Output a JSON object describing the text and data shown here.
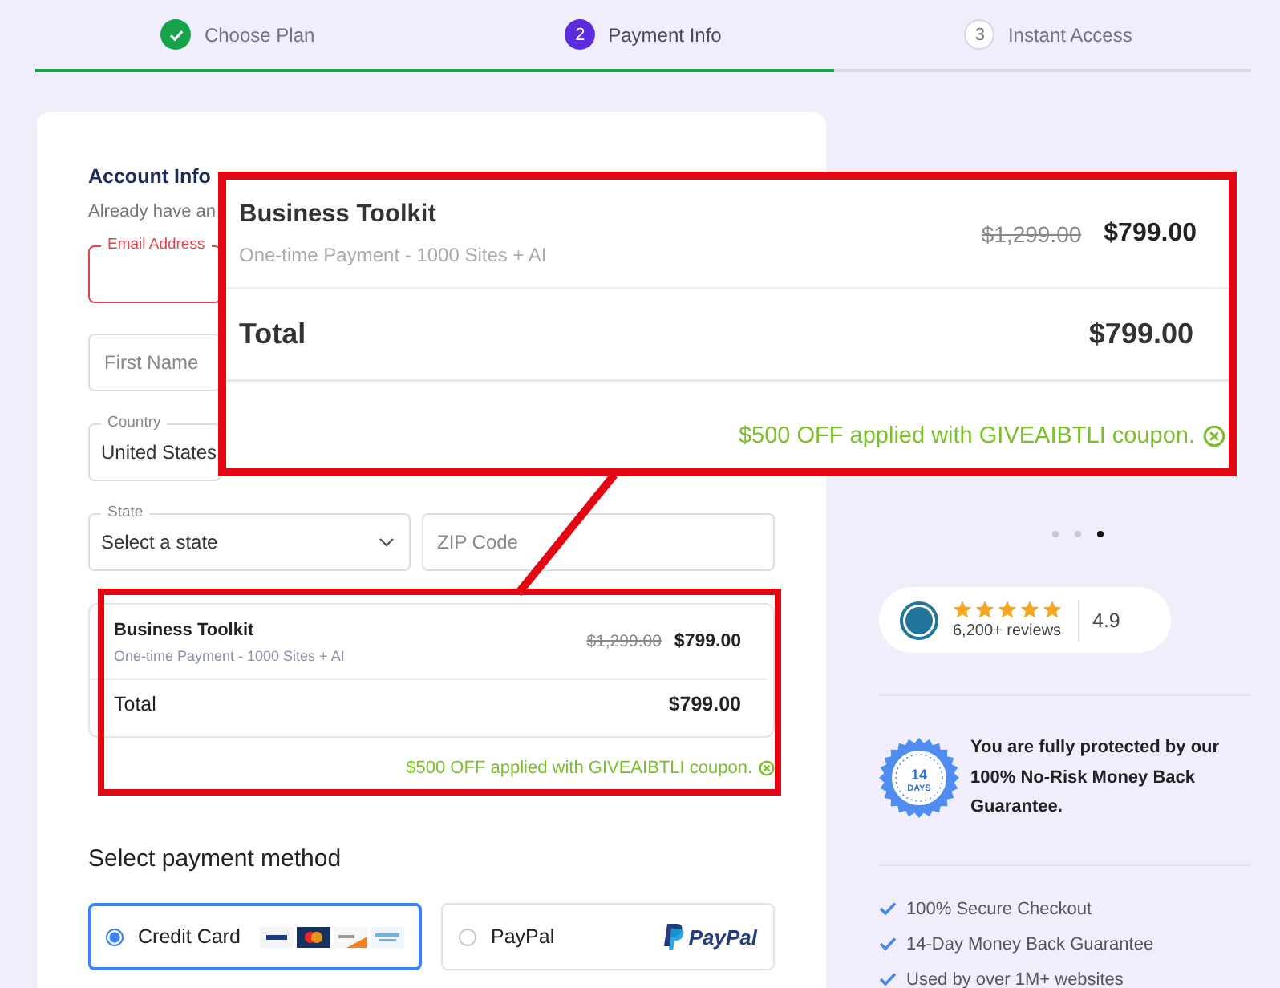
{
  "stepper": {
    "steps": [
      {
        "label": "Choose Plan",
        "completed": true,
        "selected": false
      },
      {
        "label": "Payment Info",
        "number": "2",
        "completed": false,
        "selected": true
      },
      {
        "label": "Instant Access",
        "number": "3",
        "completed": false,
        "selected": false
      }
    ],
    "progress": {
      "level": 0.657
    }
  },
  "account": {
    "heading": "Account Info",
    "subtext": "Already have an",
    "rows": [
      {
        "fields": [
          {
            "kind": "input",
            "label": "Email Address",
            "error": true
          }
        ]
      },
      {
        "fields": [
          {
            "kind": "input",
            "placeholder": "First Name",
            "error": false
          }
        ]
      },
      {
        "fields": [
          {
            "kind": "select",
            "label": "Country",
            "value": "United States",
            "error": false
          }
        ]
      },
      {
        "fields": [
          {
            "kind": "select",
            "label": "State",
            "value": "Select a state",
            "dropdown": true,
            "error": false
          },
          {
            "kind": "input",
            "placeholder": "ZIP Code",
            "error": false
          }
        ]
      }
    ]
  },
  "order_summary": {
    "item": "Business Toolkit",
    "description": "One-time Payment - 1000 Sites + AI",
    "old_price": "$1,299.00",
    "price": "$799.00",
    "total_label": "Total",
    "total": "$799.00",
    "coupon": "$500 OFF applied with GIVEAIBTLI coupon."
  },
  "payment": {
    "heading": "Select payment method",
    "methods": [
      {
        "label": "Credit Card",
        "kind": "card",
        "selected": true
      },
      {
        "label": "PayPal",
        "kind": "paypal",
        "logo": "PayPal",
        "selected": false
      }
    ]
  },
  "carousel": {
    "dots": [
      {
        "selected": false
      },
      {
        "selected": false
      },
      {
        "selected": true
      }
    ]
  },
  "reviews": {
    "stars": 5,
    "count": "6,200+ reviews",
    "rating": "4.9"
  },
  "guarantee": {
    "badge_number": "14",
    "badge_unit": "DAYS",
    "text": "You are fully protected by our 100% No-Risk Money Back Guarantee."
  },
  "features": [
    "100% Secure Checkout",
    "14-Day Money Back Guarantee",
    "Used by over 1M+ websites"
  ],
  "callout": {
    "item": "Business Toolkit",
    "description": "One-time Payment - 1000 Sites + AI",
    "old_price": "$1,299.00",
    "price": "$799.00",
    "total_label": "Total",
    "total": "$799.00",
    "coupon": "$500 OFF applied with GIVEAIBTLI coupon."
  }
}
